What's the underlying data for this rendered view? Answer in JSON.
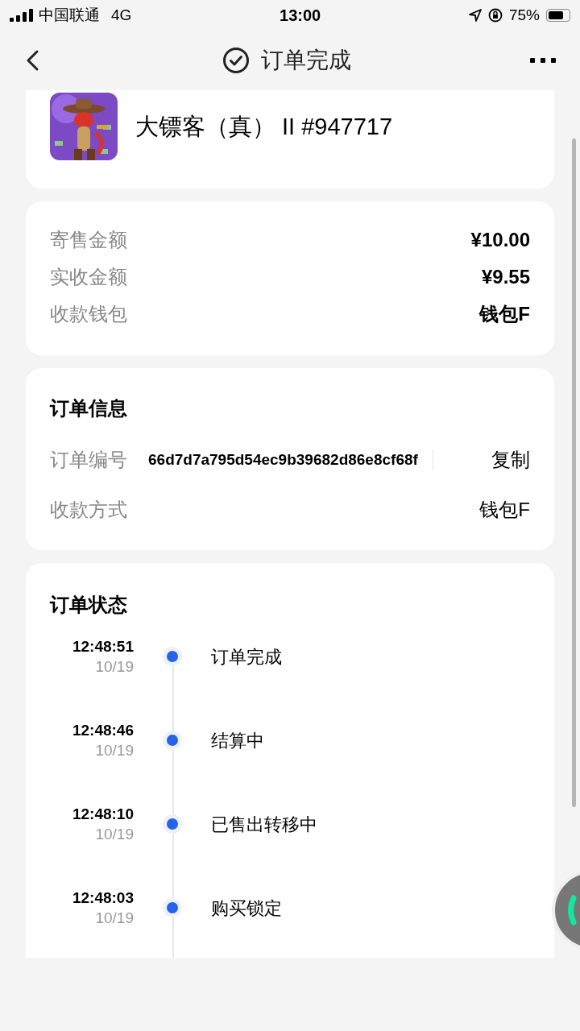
{
  "status_bar": {
    "carrier": "中国联通",
    "network": "4G",
    "time": "13:00",
    "battery": "75%"
  },
  "nav": {
    "title": "订单完成"
  },
  "product": {
    "name": "大镖客（真） II #947717"
  },
  "amounts": [
    {
      "label": "寄售金额",
      "value": "¥10.00"
    },
    {
      "label": "实收金额",
      "value": "¥9.55"
    },
    {
      "label": "收款钱包",
      "value": "钱包F"
    }
  ],
  "order_info": {
    "title": "订单信息",
    "number_label": "订单编号",
    "number": "66d7d7a795d54ec9b39682d86e8cf68f",
    "copy": "复制",
    "payment_label": "收款方式",
    "payment": "钱包F"
  },
  "order_status": {
    "title": "订单状态",
    "steps": [
      {
        "time": "12:48:51",
        "date": "10/19",
        "label": "订单完成"
      },
      {
        "time": "12:48:46",
        "date": "10/19",
        "label": "结算中"
      },
      {
        "time": "12:48:10",
        "date": "10/19",
        "label": "已售出转移中"
      },
      {
        "time": "12:48:03",
        "date": "10/19",
        "label": "购买锁定"
      }
    ]
  }
}
